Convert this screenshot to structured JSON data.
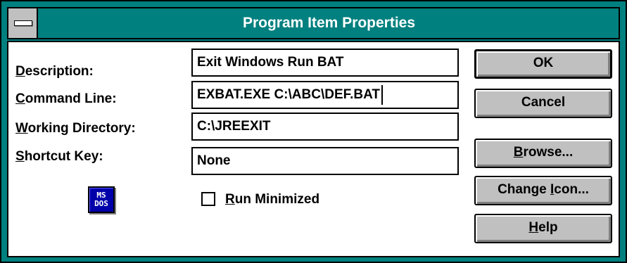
{
  "window": {
    "title": "Program Item Properties"
  },
  "form": {
    "description": {
      "acc": "D",
      "rest": "escription:",
      "value": "Exit Windows Run BAT"
    },
    "command_line": {
      "acc": "C",
      "rest": "ommand Line:",
      "value": "EXBAT.EXE C:\\ABC\\DEF.BAT"
    },
    "working_directory": {
      "acc": "W",
      "rest": "orking Directory:",
      "value": "C:\\JREEXIT"
    },
    "shortcut_key": {
      "acc": "S",
      "rest": "hortcut Key:",
      "value": "None"
    },
    "run_minimized": {
      "acc": "R",
      "rest": "un Minimized",
      "checked": false
    }
  },
  "icon": {
    "name": "ms-dos-icon",
    "line1": "MS",
    "line2": "DOS"
  },
  "buttons": {
    "ok": {
      "label": "OK"
    },
    "cancel": {
      "label": "Cancel"
    },
    "browse": {
      "acc": "B",
      "rest": "rowse..."
    },
    "change_icon": {
      "pre": "Change ",
      "acc": "I",
      "rest": "con..."
    },
    "help": {
      "acc": "H",
      "rest": "elp"
    }
  },
  "colors": {
    "titlebar": "#00807f",
    "button_face": "#c0c0c0",
    "icon_bg": "#0000aa"
  }
}
